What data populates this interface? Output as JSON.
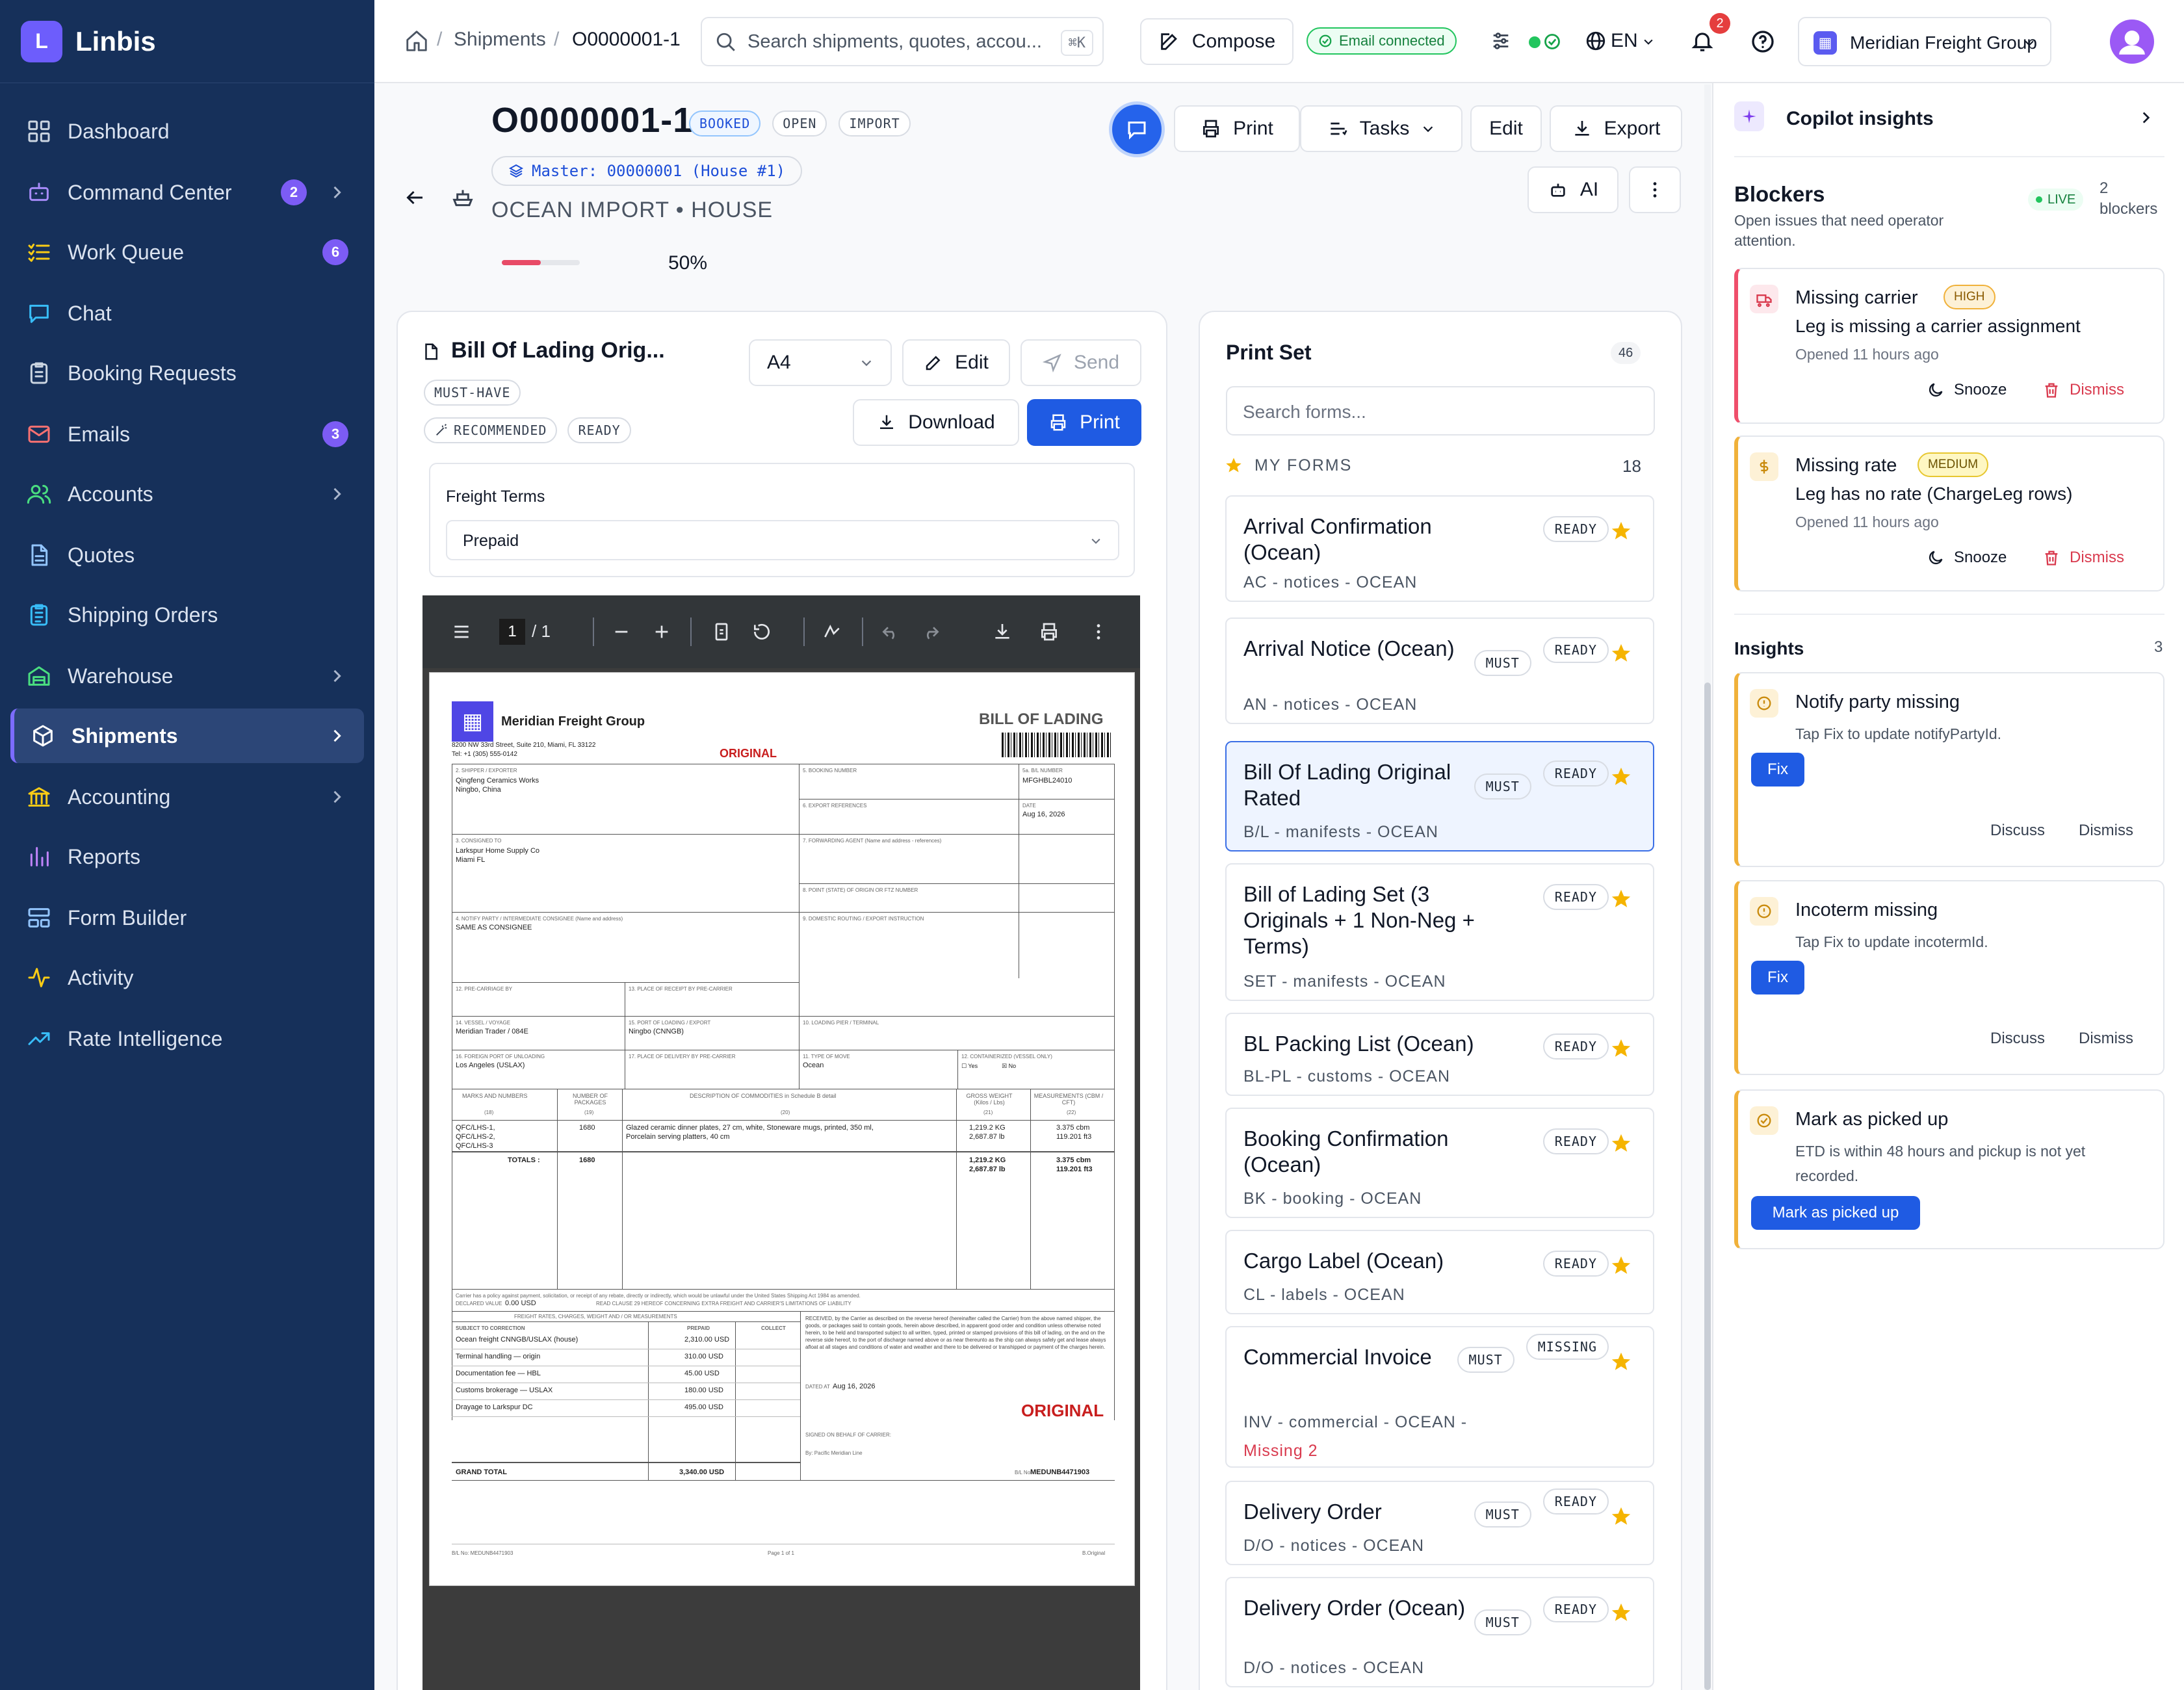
{
  "app": {
    "name": "Linbis",
    "logo_letter": "L"
  },
  "sidebar": {
    "items": [
      {
        "label": "Dashboard",
        "icon": "dashboard-icon"
      },
      {
        "label": "Command Center",
        "icon": "robot-icon",
        "badge": "2",
        "chevron": true
      },
      {
        "label": "Work Queue",
        "icon": "list-check-icon",
        "badge": "6"
      },
      {
        "label": "Chat",
        "icon": "chat-icon"
      },
      {
        "label": "Booking Requests",
        "icon": "clipboard-icon"
      },
      {
        "label": "Emails",
        "icon": "mail-icon",
        "badge": "3"
      },
      {
        "label": "Accounts",
        "icon": "users-icon",
        "chevron": true
      },
      {
        "label": "Quotes",
        "icon": "document-icon"
      },
      {
        "label": "Shipping Orders",
        "icon": "clipboard-list-icon"
      },
      {
        "label": "Warehouse",
        "icon": "warehouse-icon",
        "chevron": true
      },
      {
        "label": "Shipments",
        "icon": "box-icon",
        "chevron": true,
        "active": true
      },
      {
        "label": "Accounting",
        "icon": "bank-icon",
        "chevron": true
      },
      {
        "label": "Reports",
        "icon": "bar-chart-icon"
      },
      {
        "label": "Form Builder",
        "icon": "layout-icon"
      },
      {
        "label": "Activity",
        "icon": "activity-icon"
      },
      {
        "label": "Rate Intelligence",
        "icon": "trend-up-icon"
      }
    ]
  },
  "topbar": {
    "breadcrumb": {
      "section": "Shipments",
      "current": "O0000001-1"
    },
    "search_placeholder": "Search shipments, quotes, accou...",
    "search_shortcut": "⌘K",
    "compose_label": "Compose",
    "email_status": "Email connected",
    "language": "EN",
    "notification_count": "2",
    "org_name": "Meridian Freight Group"
  },
  "shipment": {
    "id": "O0000001-1",
    "tags": [
      "BOOKED",
      "OPEN",
      "IMPORT"
    ],
    "master": "Master: 00000001 (House #1)",
    "mode": "OCEAN IMPORT • HOUSE",
    "progress_percent": 50,
    "progress_label": "50%",
    "actions": {
      "print": "Print",
      "tasks": "Tasks",
      "edit": "Edit",
      "export": "Export",
      "ai": "AI"
    }
  },
  "form_panel": {
    "title": "Bill Of Lading Orig...",
    "tags": [
      "MUST-HAVE",
      "RECOMMENDED",
      "READY"
    ],
    "paper": "A4",
    "edit": "Edit",
    "send": "Send",
    "download": "Download",
    "print": "Print",
    "freight_terms_label": "Freight Terms",
    "freight_terms_value": "Prepaid",
    "viewer": {
      "page": "1",
      "of": "/ 1"
    }
  },
  "document": {
    "company": "Meridian Freight Group",
    "address1": "8200 NW 33rd Street, Suite 210, Miami, FL 33122",
    "address2": "Tel: +1 (305) 555-0142",
    "heading": "BILL OF LADING",
    "original": "ORIGINAL",
    "shipper_label": "2. SHIPPER / EXPORTER",
    "shipper": "Qingfeng Ceramics Works",
    "shipper_city": "Ningbo, China",
    "booking_label": "5. BOOKING NUMBER",
    "bl_label": "5a. B/L NUMBER",
    "bl_number": "MFGHBL24010",
    "export_ref_label": "6. EXPORT REFERENCES",
    "date_label": "DATE",
    "date": "Aug 16, 2026",
    "consignee_label": "3. CONSIGNED TO",
    "consignee": "Larkspur Home Supply Co",
    "consignee_city": "Miami FL",
    "forwarding_label": "7. FORWARDING AGENT (Name and address - references)",
    "point_label": "8. POINT (STATE) OF ORIGIN OR FTZ NUMBER",
    "notify_label": "4. NOTIFY PARTY / INTERMEDIATE CONSIGNEE (Name and address)",
    "notify": "SAME AS CONSIGNEE",
    "routing_label": "9. DOMESTIC ROUTING / EXPORT INSTRUCTION",
    "precarriage_label": "12. PRE-CARRIAGE BY",
    "receipt_label": "13. PLACE OF RECEIPT BY PRE-CARRIER",
    "vessel_label": "14. VESSEL / VOYAGE",
    "vessel": "Meridian Trader / 084E",
    "loading_label": "15. PORT OF LOADING / EXPORT",
    "loading": "Ningbo (CNNGB)",
    "pier_label": "10. LOADING PIER / TERMINAL",
    "unloading_label": "16. FOREIGN PORT OF UNLOADING",
    "unloading": "Los Angeles (USLAX)",
    "delivery_label": "17. PLACE OF DELIVERY BY PRE-CARRIER",
    "move_label": "11. TYPE OF MOVE",
    "move": "Ocean",
    "container_label": "12. CONTAINERIZED (VESSEL ONLY)",
    "yes": "Yes",
    "no": "No",
    "col_marks": "MARKS AND NUMBERS",
    "col_pkgs": "NUMBER OF PACKAGES",
    "col_desc": "DESCRIPTION OF COMMODITIES in Schedule B detail",
    "col_weight": "GROSS WEIGHT (Kilos / Lbs)",
    "col_meas": "MEASUREMENTS (CBM / CFT)",
    "col_nums": [
      "(18)",
      "(19)",
      "(20)",
      "(21)",
      "(22)"
    ],
    "marks": [
      "QFC/LHS-1,",
      "QFC/LHS-2,",
      "QFC/LHS-3"
    ],
    "packages": "1680",
    "desc1": "Glazed ceramic dinner plates, 27 cm, white, Stoneware mugs, printed, 350 ml,",
    "desc2": "Porcelain serving platters, 40 cm",
    "weight1": "1,219.2 KG",
    "weight2": "2,687.87 lb",
    "meas1": "3.375 cbm",
    "meas2": "119.201 ft3",
    "totals_label": "TOTALS :",
    "totals_pkgs": "1680",
    "disclaimer1": "Carrier has a policy against payment, solicitation, or receipt of any rebate, directly or indirectly, which would be unlawful under the United States Shipping Act 1984 as amended.",
    "declared_label": "DECLARED VALUE",
    "declared": "0.00 USD",
    "disclaimer2": "READ CLAUSE 29 HEREOF CONCERNING EXTRA FREIGHT AND CARRIER'S LIMITATIONS OF LIABILITY",
    "charges_header": "FREIGHT RATES, CHARGES, WEIGHT AND / OR MEASUREMENTS",
    "charges_cols": [
      "SUBJECT TO CORRECTION",
      "PREPAID",
      "COLLECT"
    ],
    "charges": [
      {
        "name": "Ocean freight CNNGB/USLAX (house)",
        "amount": "2,310.00 USD"
      },
      {
        "name": "Terminal handling — origin",
        "amount": "310.00 USD"
      },
      {
        "name": "Documentation fee — HBL",
        "amount": "45.00 USD"
      },
      {
        "name": "Customs brokerage — USLAX",
        "amount": "180.00 USD"
      },
      {
        "name": "Drayage to Larkspur DC",
        "amount": "495.00 USD"
      }
    ],
    "grand_total_label": "GRAND TOTAL",
    "grand_total": "3,340.00 USD",
    "received_text": "RECEIVED, by the Carrier as described on the reverse hereof (hereinafter called the Carrier) from the above named shipper, the goods, or packages said to contain goods, herein above described, in apparent good order and condition unless otherwise noted herein, to be held and transported subject to all written, typed, printed or stamped provisions of this bill of lading, on the and on the reverse side hereof, to the port of discharge named above or as near thereunto as the ship can always safely get and lease always afloat at all stages and conditions of water and weather and there to be delivered or transhipped or payment of the charges herein.",
    "dated_label": "DATED AT",
    "dated": "Aug 16, 2026",
    "signed_label": "SIGNED ON BEHALF OF CARRIER:",
    "signed_by": "By: Pacific Meridian Line",
    "footer_bl_label": "B/L No.",
    "footer_bl": "MEDUNB4471903",
    "footer_left": "B/L No: MEDUNB4471903",
    "footer_mid": "Page 1 of 1",
    "footer_right": "B.Original"
  },
  "print_set": {
    "title": "Print Set",
    "count": "46",
    "search_placeholder": "Search forms...",
    "my_forms_label": "MY FORMS",
    "my_forms_count": "18",
    "forms": [
      {
        "name": "Arrival Confirmation (Ocean)",
        "code": "AC",
        "cat": "notices",
        "mode": "OCEAN",
        "must": false,
        "status": "READY"
      },
      {
        "name": "Arrival Notice (Ocean)",
        "code": "AN",
        "cat": "notices",
        "mode": "OCEAN",
        "must": true,
        "status": "READY"
      },
      {
        "name": "Bill Of Lading Original Rated",
        "code": "B/L",
        "cat": "manifests",
        "mode": "OCEAN",
        "must": true,
        "status": "READY",
        "selected": true
      },
      {
        "name": "Bill of Lading Set (3 Originals + 1 Non-Neg + Terms)",
        "code": "SET",
        "cat": "manifests",
        "mode": "OCEAN",
        "must": false,
        "status": "READY"
      },
      {
        "name": "BL Packing List (Ocean)",
        "code": "BL-PL",
        "cat": "customs",
        "mode": "OCEAN",
        "must": false,
        "status": "READY"
      },
      {
        "name": "Booking Confirmation (Ocean)",
        "code": "BK",
        "cat": "booking",
        "mode": "OCEAN",
        "must": false,
        "status": "READY"
      },
      {
        "name": "Cargo Label (Ocean)",
        "code": "CL",
        "cat": "labels",
        "mode": "OCEAN",
        "must": false,
        "status": "READY"
      },
      {
        "name": "Commercial Invoice",
        "code": "INV",
        "cat": "commercial",
        "mode": "OCEAN",
        "must": true,
        "status": "MISSING",
        "missing": "Missing 2"
      },
      {
        "name": "Delivery Order",
        "code": "D/O",
        "cat": "notices",
        "mode": "OCEAN",
        "must": true,
        "status": "READY"
      },
      {
        "name": "Delivery Order (Ocean)",
        "code": "D/O",
        "cat": "notices",
        "mode": "OCEAN",
        "must": true,
        "status": "READY"
      }
    ]
  },
  "copilot": {
    "title": "Copilot insights",
    "blockers_title": "Blockers",
    "blockers_sub": "Open issues that need operator attention.",
    "live": "LIVE",
    "blockers_count": "2",
    "blockers_count_label": "blockers",
    "blockers": [
      {
        "title": "Missing carrier",
        "level": "HIGH",
        "desc": "Leg is missing a carrier assignment",
        "opened": "Opened 11 hours ago",
        "snooze": "Snooze",
        "dismiss": "Dismiss"
      },
      {
        "title": "Missing rate",
        "level": "MEDIUM",
        "desc": "Leg has no rate (ChargeLeg rows)",
        "opened": "Opened 11 hours ago",
        "snooze": "Snooze",
        "dismiss": "Dismiss"
      }
    ],
    "insights_title": "Insights",
    "insights_count": "3",
    "insights": [
      {
        "title": "Notify party missing",
        "desc": "Tap Fix to update notifyPartyId.",
        "action": "Fix",
        "discuss": "Discuss",
        "dismiss": "Dismiss"
      },
      {
        "title": "Incoterm missing",
        "desc": "Tap Fix to update incotermId.",
        "action": "Fix",
        "discuss": "Discuss",
        "dismiss": "Dismiss"
      },
      {
        "title": "Mark as picked up",
        "desc": "ETD is within 48 hours and pickup is not yet recorded.",
        "action": "Mark as picked up"
      }
    ]
  },
  "colors": {
    "sidebar": "#16305a",
    "accent": "#1f5be3",
    "badge": "#7c5cf5",
    "danger": "#d93a4e",
    "warning": "#f0b13a"
  }
}
